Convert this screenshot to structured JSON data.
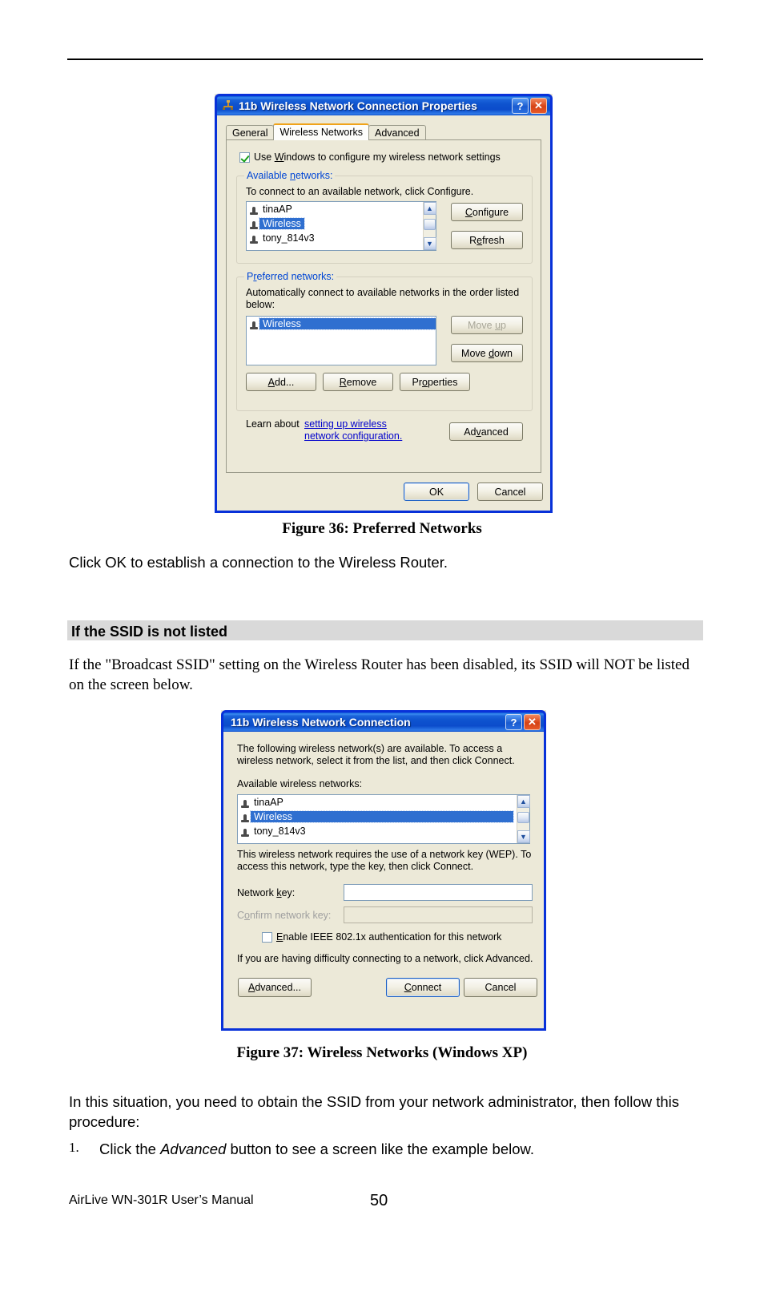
{
  "document": {
    "figure36_caption": "Figure 36: Preferred Networks",
    "para_after_fig36": "Click OK to establish a connection to the Wireless Router.",
    "section_heading": "If the SSID is not listed",
    "para_ssid_not_listed": "If the \"Broadcast SSID\" setting on the Wireless Router has been disabled, its SSID will NOT be listed on the screen below.",
    "figure37_caption": "Figure 37: Wireless Networks (Windows XP)",
    "para_situation": "In this situation, you need to obtain the SSID from your network administrator, then follow this procedure:",
    "list_number": "1.",
    "list_item_1_pre": "Click the ",
    "list_item_1_em": "Advanced",
    "list_item_1_post": " button to see a screen like the example below.",
    "footer_left": "AirLive WN-301R User’s Manual",
    "footer_page": "50"
  },
  "dialog1": {
    "title": "11b Wireless Network Connection Properties",
    "app_icon": "network-connection-icon",
    "help_button": "?",
    "close_button": "✕",
    "tabs": [
      {
        "label": "General",
        "active": false
      },
      {
        "label": "Wireless Networks",
        "active": true
      },
      {
        "label": "Advanced",
        "active": false
      }
    ],
    "use_windows_checkbox": {
      "label_pre": "Use ",
      "label_accel": "W",
      "label_post": "indows to configure my wireless network settings",
      "checked": true
    },
    "available_group": {
      "label_pre": "Available ",
      "label_accel": "n",
      "label_post": "etworks:",
      "hint": "To connect to an available network, click Configure.",
      "items": [
        {
          "name": "tinaAP",
          "selected": false
        },
        {
          "name": "Wireless",
          "selected": true
        },
        {
          "name": "tony_814v3",
          "selected": false
        }
      ],
      "configure_button": "Configure",
      "refresh_button": "Refresh"
    },
    "preferred_group": {
      "label_pre": "P",
      "label_accel": "r",
      "label_post": "eferred networks:",
      "hint": "Automatically connect to available networks in the order listed below:",
      "items": [
        {
          "name": "Wireless",
          "selected": true
        }
      ],
      "move_up_button": "Move up",
      "move_up_disabled": true,
      "move_down_button": "Move down",
      "add_button": "Add...",
      "remove_button": "Remove",
      "properties_button": "Properties"
    },
    "learn_prefix": "Learn about ",
    "learn_link": "setting up wireless network configuration.",
    "advanced_button": "Advanced",
    "ok_button": "OK",
    "cancel_button": "Cancel"
  },
  "dialog2": {
    "title": "11b Wireless Network Connection",
    "help_button": "?",
    "close_button": "✕",
    "intro": "The following wireless network(s) are available. To access a wireless network, select it from the list, and then click Connect.",
    "available_label": "Available wireless networks:",
    "items": [
      {
        "name": "tinaAP",
        "selected": false
      },
      {
        "name": "Wireless",
        "selected": true
      },
      {
        "name": "tony_814v3",
        "selected": false
      }
    ],
    "wep_note": "This wireless network requires the use of a network key (WEP). To access this network, type the key, then click Connect.",
    "network_key_label": "Network key:",
    "network_key_value": "",
    "confirm_key_label": "Confirm network key:",
    "confirm_key_value": "",
    "confirm_key_disabled": true,
    "enable_8021x_label": "Enable IEEE 802.1x authentication for this network",
    "enable_8021x_checked": false,
    "difficulty_note": "If you are having difficulty connecting to a network, click Advanced.",
    "advanced_button": "Advanced...",
    "connect_button": "Connect",
    "cancel_button": "Cancel"
  },
  "colors": {
    "titlebar_blue": "#0831d9",
    "dialog_face": "#ece9d8",
    "selection_blue": "#2f6fd0",
    "group_label_blue": "#0046d5",
    "tab_active_orange": "#f0a31a",
    "link_blue": "#0000cc",
    "section_band_gray": "#d9d9d9"
  }
}
